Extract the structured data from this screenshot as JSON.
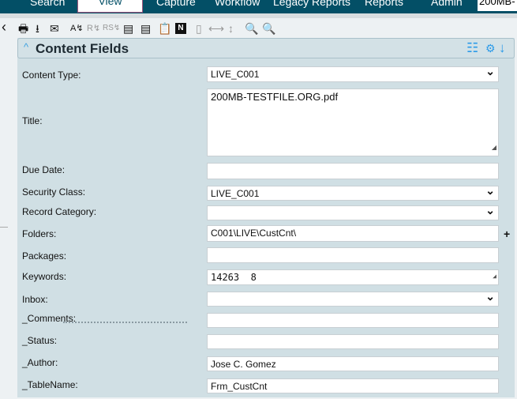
{
  "nav": {
    "items": [
      "Search",
      "View",
      "Capture",
      "Workflow",
      "Legacy Reports",
      "Reports",
      "Admin"
    ],
    "selected": "View",
    "search_value": "200MB-"
  },
  "toolbar": {
    "back": "‹",
    "icons": [
      "print-icon",
      "download-icon",
      "email-icon",
      "spell-route-icon",
      "route-r-icon",
      "route-rs-icon",
      "checklist-icon",
      "clear-list-icon",
      "clipboard-search-icon",
      "notes-icon",
      "column-icon",
      "fit-width-icon",
      "fit-height-icon",
      "zoom-out-icon",
      "zoom-in-icon"
    ]
  },
  "panel": {
    "title": "Content Fields",
    "chevron": "^"
  },
  "fields": [
    {
      "label": "Content Type:",
      "value": "LIVE_C001",
      "type": "select"
    },
    {
      "label": "Title:",
      "value": "200MB-TESTFILE.ORG.pdf",
      "type": "textarea"
    },
    {
      "label": "Due Date:",
      "value": "",
      "type": "input"
    },
    {
      "label": "Security Class:",
      "value": "LIVE_C001",
      "type": "select"
    },
    {
      "label": "Record Category:",
      "value": "",
      "type": "select"
    },
    {
      "label": "Folders:",
      "value": "C001\\LIVE\\CustCnt\\",
      "type": "input"
    },
    {
      "label": "Packages:",
      "value": "",
      "type": "input"
    },
    {
      "label": "Keywords:",
      "value": "14263  8",
      "type": "textarea"
    },
    {
      "label": "Inbox:",
      "value": "",
      "type": "select"
    },
    {
      "label": "_Comments:",
      "value": "",
      "type": "input"
    },
    {
      "label": "_Status:",
      "value": "",
      "type": "input"
    },
    {
      "label": "_Author:",
      "value": "Jose C. Gomez",
      "type": "input"
    },
    {
      "label": "_TableName:",
      "value": "Frm_CustCnt",
      "type": "input"
    }
  ],
  "accent": "#2b9ae8",
  "nav_bg": "#034f66"
}
